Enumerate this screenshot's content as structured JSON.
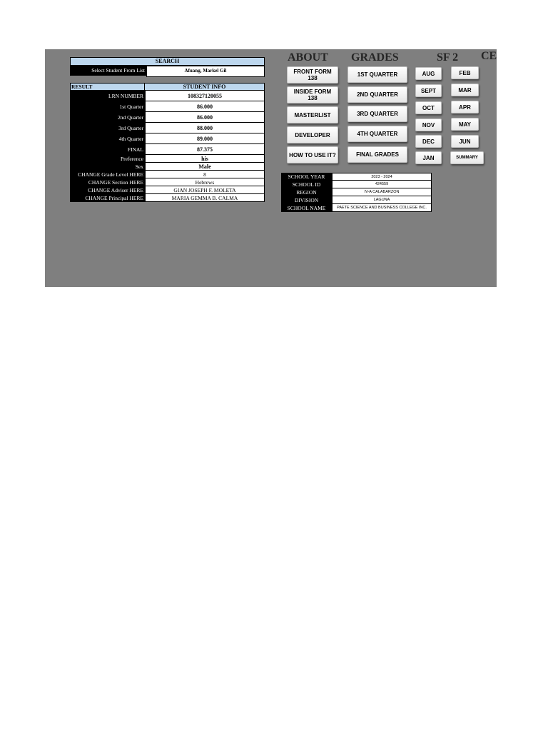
{
  "search": {
    "header": "SEARCH",
    "select_label": "Select Student From List",
    "selected_student": "Afuang, Markel Gil"
  },
  "result": {
    "left_header": "RESULT",
    "right_header": "STUDENT INFO",
    "rows": [
      {
        "label": "LRN NUMBER",
        "value": "108327120055"
      },
      {
        "label": "1st Quarter",
        "value": "86.000"
      },
      {
        "label": "2nd Quarter",
        "value": "86.000"
      },
      {
        "label": "3rd Quarter",
        "value": "88.000"
      },
      {
        "label": "4th Quarter",
        "value": "89.000"
      },
      {
        "label": "FINAL",
        "value": "87.375"
      },
      {
        "label": "Preference",
        "value": "his"
      },
      {
        "label": "Sex",
        "value": "Male"
      },
      {
        "label": "CHANGE Grade Level HERE",
        "value": "8"
      },
      {
        "label": "CHANGE Section HERE",
        "value": "Hebrews"
      },
      {
        "label": "CHANGE Adviser HERE",
        "value": "GIAN JOSEPH F. MOLETA"
      },
      {
        "label": "CHANGE Principal HERE",
        "value": "MARIA GEMMA B. CALMA"
      }
    ]
  },
  "headers": {
    "about": "ABOUT",
    "grades": "GRADES",
    "sf2": "SF 2",
    "cert": "CE"
  },
  "buttons": {
    "about": [
      "FRONT FORM 138",
      "INSIDE FORM 138",
      "MASTERLIST",
      "DEVELOPER",
      "HOW TO USE IT?"
    ],
    "grades": [
      "1ST QUARTER",
      "2ND QUARTER",
      "3RD QUARTER",
      "4TH QUARTER",
      "FINAL GRADES"
    ],
    "months_left": [
      "AUG",
      "SEPT",
      "OCT",
      "NOV",
      "DEC",
      "JAN"
    ],
    "months_right": [
      "FEB",
      "MAR",
      "APR",
      "MAY",
      "JUN",
      "SUMMARY"
    ]
  },
  "school": {
    "rows": [
      {
        "label": "SCHOOL YEAR",
        "value": "2023 - 2024"
      },
      {
        "label": "SCHOOL ID",
        "value": "424559"
      },
      {
        "label": "REGION",
        "value": "IV-A CALABARZON"
      },
      {
        "label": "DIVISION",
        "value": "LAGUNA"
      },
      {
        "label": "SCHOOL NAME",
        "value": "PAETE SCIENCE AND BUSINESS COLLEGE INC."
      }
    ]
  },
  "colors": {
    "sheet_bg": "#7f7f7f",
    "header_blue": "#bdd7ee"
  }
}
